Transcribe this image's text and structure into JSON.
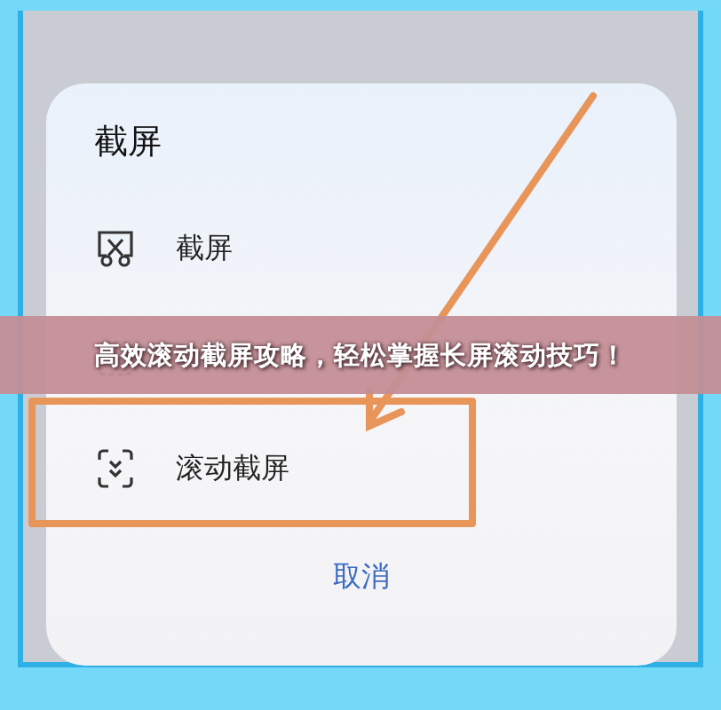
{
  "dialog": {
    "title": "截屏",
    "options": [
      {
        "label": "截屏",
        "kind": "screenshot",
        "highlighted": false
      },
      {
        "kind": "partial",
        "highlighted": false
      },
      {
        "label": "滚动截屏",
        "kind": "scroll",
        "highlighted": true
      }
    ],
    "cancel": "取消"
  },
  "banner": {
    "text": "高效滚动截屏攻略，轻松掌握长屏滚动技巧！"
  }
}
